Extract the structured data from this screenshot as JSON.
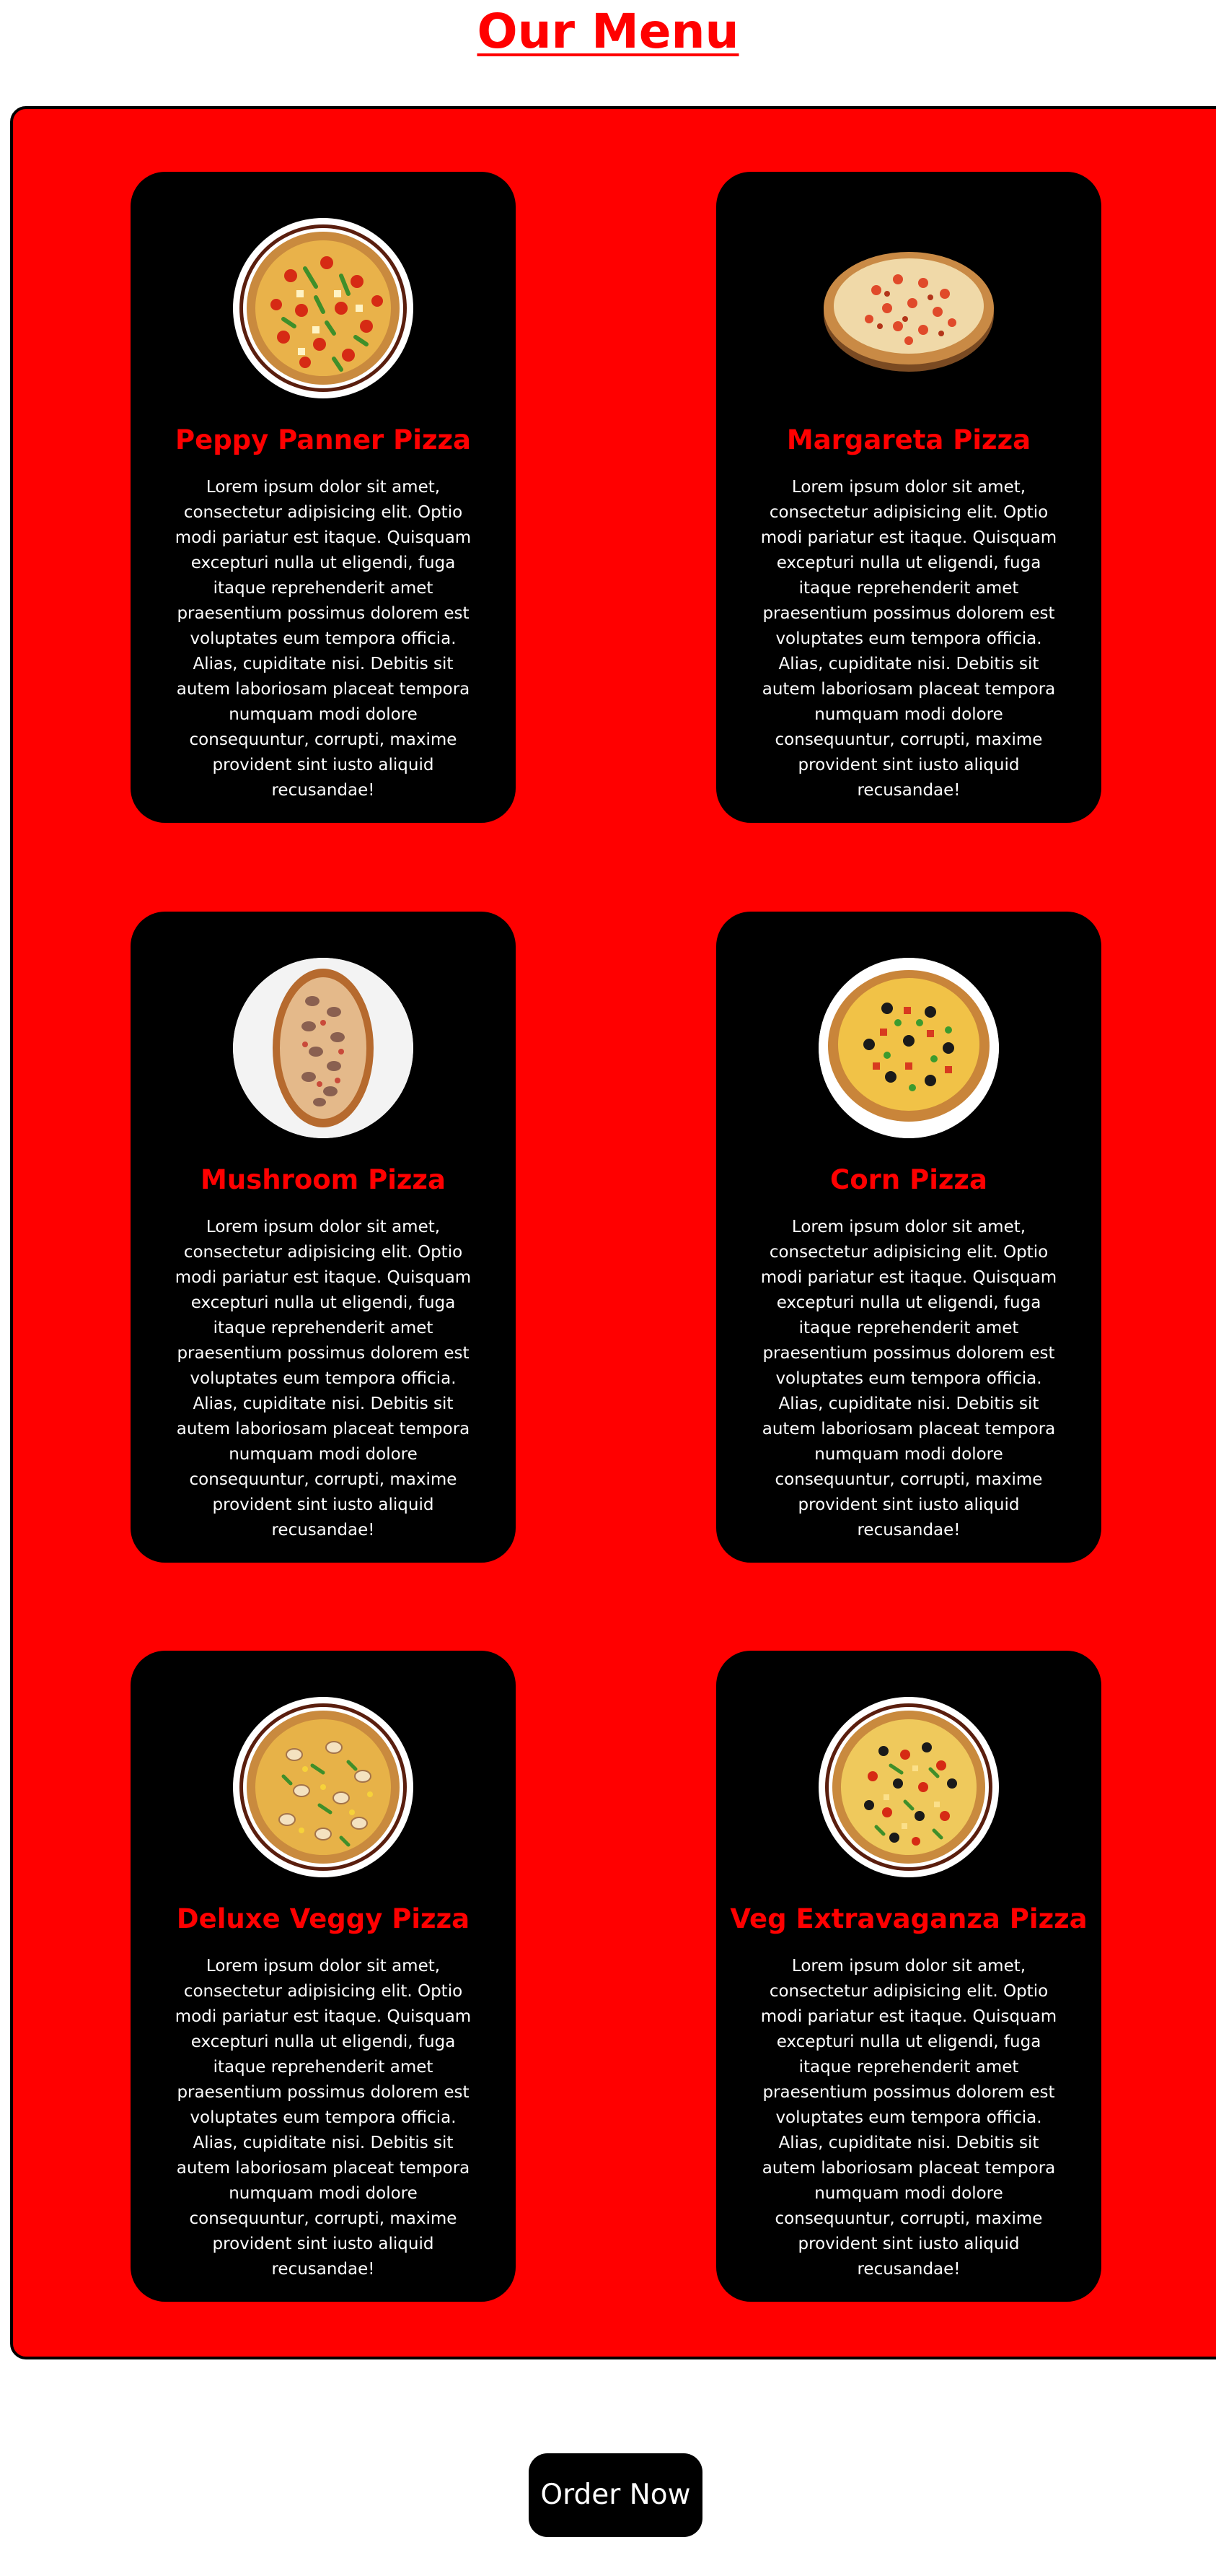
{
  "page": {
    "title": "Our Menu"
  },
  "colors": {
    "accent": "#ff0000",
    "card_background": "#000000",
    "text_on_card": "#ffffff",
    "page_background": "#ffffff"
  },
  "menu": {
    "items": [
      {
        "name": "Peppy Panner Pizza",
        "description": "Lorem ipsum dolor sit amet, consectetur adipisicing elit. Optio modi pariatur est itaque. Quisquam excepturi nulla ut eligendi, fuga itaque reprehenderit amet praesentium possimus dolorem est voluptates eum tempora officia. Alias, cupiditate nisi. Debitis sit autem laboriosam placeat tempora numquam modi dolore consequuntur, corrupti, maxime provident sint iusto aliquid recusandae!",
        "image": "peppy-paneer-pizza-image"
      },
      {
        "name": "Margareta Pizza",
        "description": "Lorem ipsum dolor sit amet, consectetur adipisicing elit. Optio modi pariatur est itaque. Quisquam excepturi nulla ut eligendi, fuga itaque reprehenderit amet praesentium possimus dolorem est voluptates eum tempora officia. Alias, cupiditate nisi. Debitis sit autem laboriosam placeat tempora numquam modi dolore consequuntur, corrupti, maxime provident sint iusto aliquid recusandae!",
        "image": "margherita-pizza-image"
      },
      {
        "name": "Mushroom Pizza",
        "description": "Lorem ipsum dolor sit amet, consectetur adipisicing elit. Optio modi pariatur est itaque. Quisquam excepturi nulla ut eligendi, fuga itaque reprehenderit amet praesentium possimus dolorem est voluptates eum tempora officia. Alias, cupiditate nisi. Debitis sit autem laboriosam placeat tempora numquam modi dolore consequuntur, corrupti, maxime provident sint iusto aliquid recusandae!",
        "image": "mushroom-pizza-image"
      },
      {
        "name": "Corn Pizza",
        "description": "Lorem ipsum dolor sit amet, consectetur adipisicing elit. Optio modi pariatur est itaque. Quisquam excepturi nulla ut eligendi, fuga itaque reprehenderit amet praesentium possimus dolorem est voluptates eum tempora officia. Alias, cupiditate nisi. Debitis sit autem laboriosam placeat tempora numquam modi dolore consequuntur, corrupti, maxime provident sint iusto aliquid recusandae!",
        "image": "corn-pizza-image"
      },
      {
        "name": "Deluxe Veggy Pizza",
        "description": "Lorem ipsum dolor sit amet, consectetur adipisicing elit. Optio modi pariatur est itaque. Quisquam excepturi nulla ut eligendi, fuga itaque reprehenderit amet praesentium possimus dolorem est voluptates eum tempora officia. Alias, cupiditate nisi. Debitis sit autem laboriosam placeat tempora numquam modi dolore consequuntur, corrupti, maxime provident sint iusto aliquid recusandae!",
        "image": "deluxe-veggie-pizza-image"
      },
      {
        "name": "Veg Extravaganza Pizza",
        "description": "Lorem ipsum dolor sit amet, consectetur adipisicing elit. Optio modi pariatur est itaque. Quisquam excepturi nulla ut eligendi, fuga itaque reprehenderit amet praesentium possimus dolorem est voluptates eum tempora officia. Alias, cupiditate nisi. Debitis sit autem laboriosam placeat tempora numquam modi dolore consequuntur, corrupti, maxime provident sint iusto aliquid recusandae!",
        "image": "veg-extravaganza-pizza-image"
      }
    ]
  },
  "order_button": {
    "label": "Order Now"
  }
}
